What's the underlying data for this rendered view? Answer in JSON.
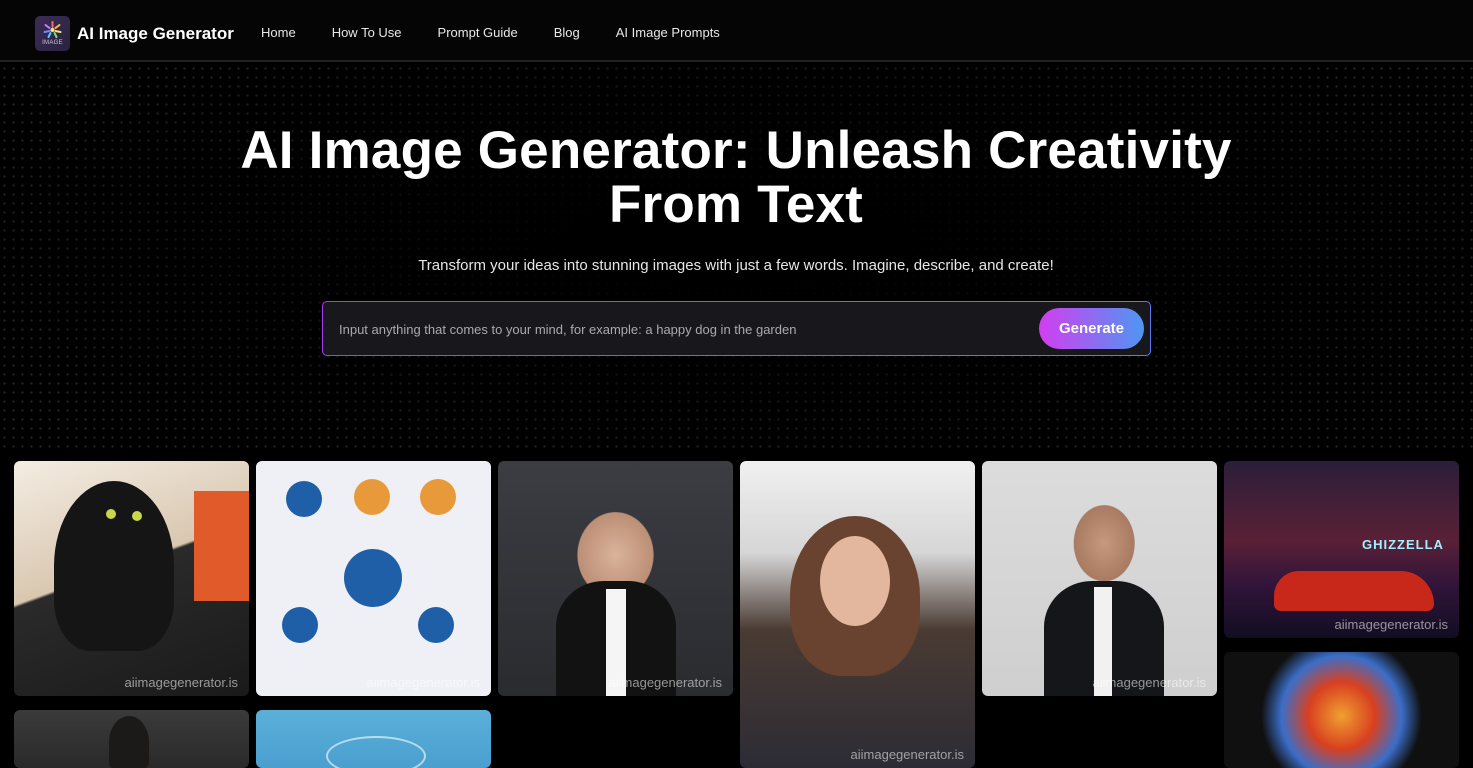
{
  "header": {
    "logo_text": "IMAGE",
    "brand": "AI Image Generator",
    "nav": [
      "Home",
      "How To Use",
      "Prompt Guide",
      "Blog",
      "AI Image Prompts"
    ]
  },
  "hero": {
    "title": "AI Image Generator: Unleash Creativity From Text",
    "subtitle": "Transform your ideas into stunning images with just a few words. Imagine, describe, and create!",
    "search_placeholder": "Input anything that comes to your mind, for example: a happy dog in the garden",
    "generate_label": "Generate"
  },
  "gallery": {
    "watermark": "aiimagegenerator.is",
    "items": [
      {
        "name": "black-cat-drawing"
      },
      {
        "name": "lead-generation-diagram"
      },
      {
        "name": "woman-tuxedo-laughing"
      },
      {
        "name": "girl-snow-selfie"
      },
      {
        "name": "woman-tuxedo-serious"
      },
      {
        "name": "red-car-neon",
        "sign_text": "GHIZZELLA"
      },
      {
        "name": "phoenix-emblem"
      },
      {
        "name": "armored-figure"
      },
      {
        "name": "blue-network-illustration"
      }
    ]
  },
  "colors": {
    "accent_start": "#d23ef0",
    "accent_end": "#4f96f2",
    "background": "#000000"
  }
}
